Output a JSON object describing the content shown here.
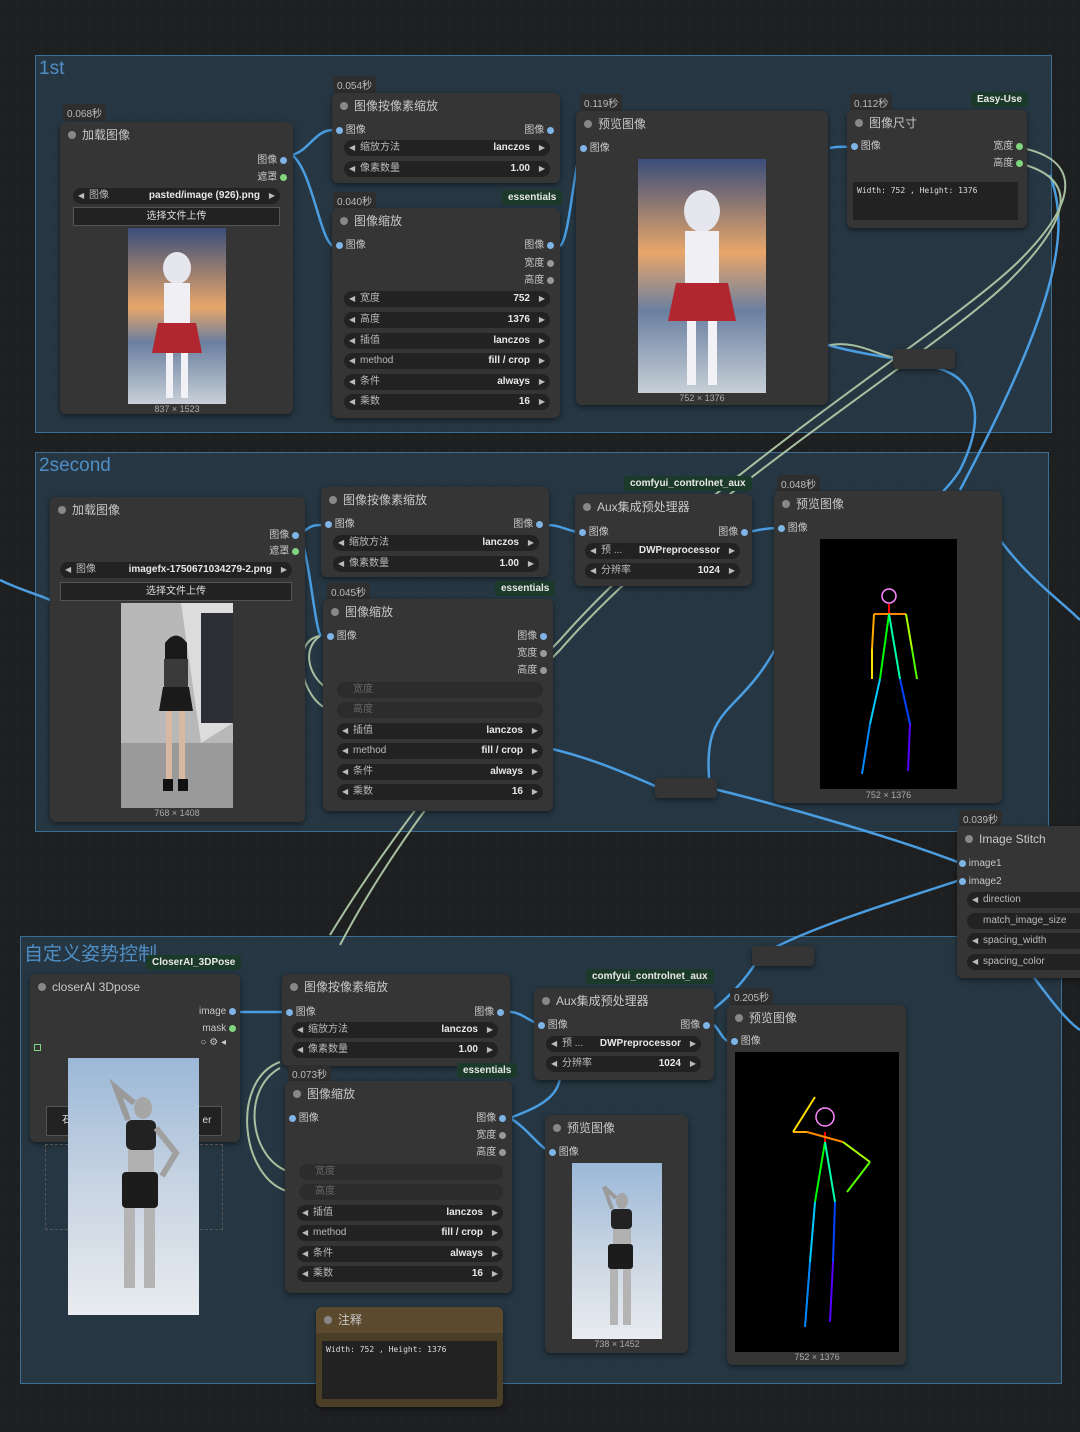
{
  "groups": {
    "g1": "1st",
    "g2": "2second",
    "g3": "自定义姿势控制"
  },
  "n_load1": {
    "time": "0.068秒",
    "title": "加载图像",
    "out1": "图像",
    "out2": "遮罩",
    "img_label": "图像",
    "img_value": "pasted/image (926).png",
    "upload": "选择文件上传",
    "caption": "837 × 1523"
  },
  "n_scale1": {
    "time": "0.054秒",
    "title": "图像按像素缩放",
    "in1": "图像",
    "out1": "图像",
    "w1_label": "缩放方法",
    "w1_value": "lanczos",
    "w2_label": "像素数量",
    "w2_value": "1.00"
  },
  "n_resize1": {
    "time": "0.040秒",
    "badge": "essentials",
    "title": "图像缩放",
    "in1": "图像",
    "out1": "图像",
    "out2": "宽度",
    "out3": "高度",
    "widgets": [
      {
        "label": "宽度",
        "value": "752"
      },
      {
        "label": "高度",
        "value": "1376"
      },
      {
        "label": "插值",
        "value": "lanczos"
      },
      {
        "label": "method",
        "value": "fill / crop"
      },
      {
        "label": "条件",
        "value": "always"
      },
      {
        "label": "乘数",
        "value": "16"
      }
    ]
  },
  "n_prev1": {
    "time": "0.119秒",
    "title": "预览图像",
    "in1": "图像",
    "caption": "752 × 1376"
  },
  "n_size": {
    "time": "0.112秒",
    "badge": "Easy-Use",
    "title": "图像尺寸",
    "in1": "图像",
    "out1": "宽度",
    "out2": "高度",
    "text": "Width: 752 , Height: 1376"
  },
  "n_load2": {
    "title": "加载图像",
    "out1": "图像",
    "out2": "遮罩",
    "img_label": "图像",
    "img_value": "imagefx-1750671034279-2.png",
    "upload": "选择文件上传",
    "caption": "768 × 1408"
  },
  "n_scale2": {
    "title": "图像按像素缩放",
    "in1": "图像",
    "out1": "图像",
    "w1_label": "缩放方法",
    "w1_value": "lanczos",
    "w2_label": "像素数量",
    "w2_value": "1.00"
  },
  "n_resize2": {
    "time": "0.045秒",
    "badge": "essentials",
    "title": "图像缩放",
    "in1": "图像",
    "out1": "图像",
    "out2": "宽度",
    "out3": "高度",
    "widgets": [
      {
        "label": "宽度",
        "value": ""
      },
      {
        "label": "高度",
        "value": ""
      },
      {
        "label": "插值",
        "value": "lanczos"
      },
      {
        "label": "method",
        "value": "fill / crop"
      },
      {
        "label": "条件",
        "value": "always"
      },
      {
        "label": "乘数",
        "value": "16"
      }
    ]
  },
  "n_aux2": {
    "badge": "comfyui_controlnet_aux",
    "title": "Aux集成预处理器",
    "in1": "图像",
    "out1": "图像",
    "w1_label": "预 ...",
    "w1_value": "DWPreprocessor",
    "w2_label": "分辨率",
    "w2_value": "1024"
  },
  "n_prev2": {
    "time": "0.048秒",
    "title": "预览图像",
    "in1": "图像",
    "caption": "752 × 1376"
  },
  "n_stitch": {
    "time": "0.039秒",
    "title": "Image Stitch",
    "in1": "image1",
    "in2": "image2",
    "w": [
      "direction",
      "match_image_size",
      "spacing_width",
      "spacing_color"
    ]
  },
  "n_3d": {
    "badge": "CloserAI_3DPose",
    "title": "closerAI 3Dpose",
    "out1": "image",
    "out2": "mask",
    "btn_left": "石",
    "btn_right": "er"
  },
  "n_scale3": {
    "title": "图像按像素缩放",
    "in1": "图像",
    "out1": "图像",
    "w1_label": "缩放方法",
    "w1_value": "lanczos",
    "w2_label": "像素数量",
    "w2_value": "1.00"
  },
  "n_resize3": {
    "time": "0.073秒",
    "badge": "essentials",
    "title": "图像缩放",
    "in1": "图像",
    "out1": "图像",
    "out2": "宽度",
    "out3": "高度",
    "widgets": [
      {
        "label": "宽度",
        "value": ""
      },
      {
        "label": "高度",
        "value": ""
      },
      {
        "label": "插值",
        "value": "lanczos"
      },
      {
        "label": "method",
        "value": "fill / crop"
      },
      {
        "label": "条件",
        "value": "always"
      },
      {
        "label": "乘数",
        "value": "16"
      }
    ]
  },
  "n_aux3": {
    "badge": "comfyui_controlnet_aux",
    "title": "Aux集成预处理器",
    "in1": "图像",
    "out1": "图像",
    "w1_label": "预 ...",
    "w1_value": "DWPreprocessor",
    "w2_label": "分辨率",
    "w2_value": "1024"
  },
  "n_prev3a": {
    "title": "预览图像",
    "in1": "图像",
    "caption": "738 × 1452"
  },
  "n_prev3b": {
    "time": "0.205秒",
    "title": "预览图像",
    "in1": "图像",
    "caption": "752 × 1376"
  },
  "n_note": {
    "title": "注释",
    "text": "Width: 752 , Height: 1376"
  },
  "colors": {
    "group_border": "#3b6e93",
    "wire_image": "#4a9de0",
    "wire_int": "#a8c0a0",
    "node_bg": "#353535"
  }
}
